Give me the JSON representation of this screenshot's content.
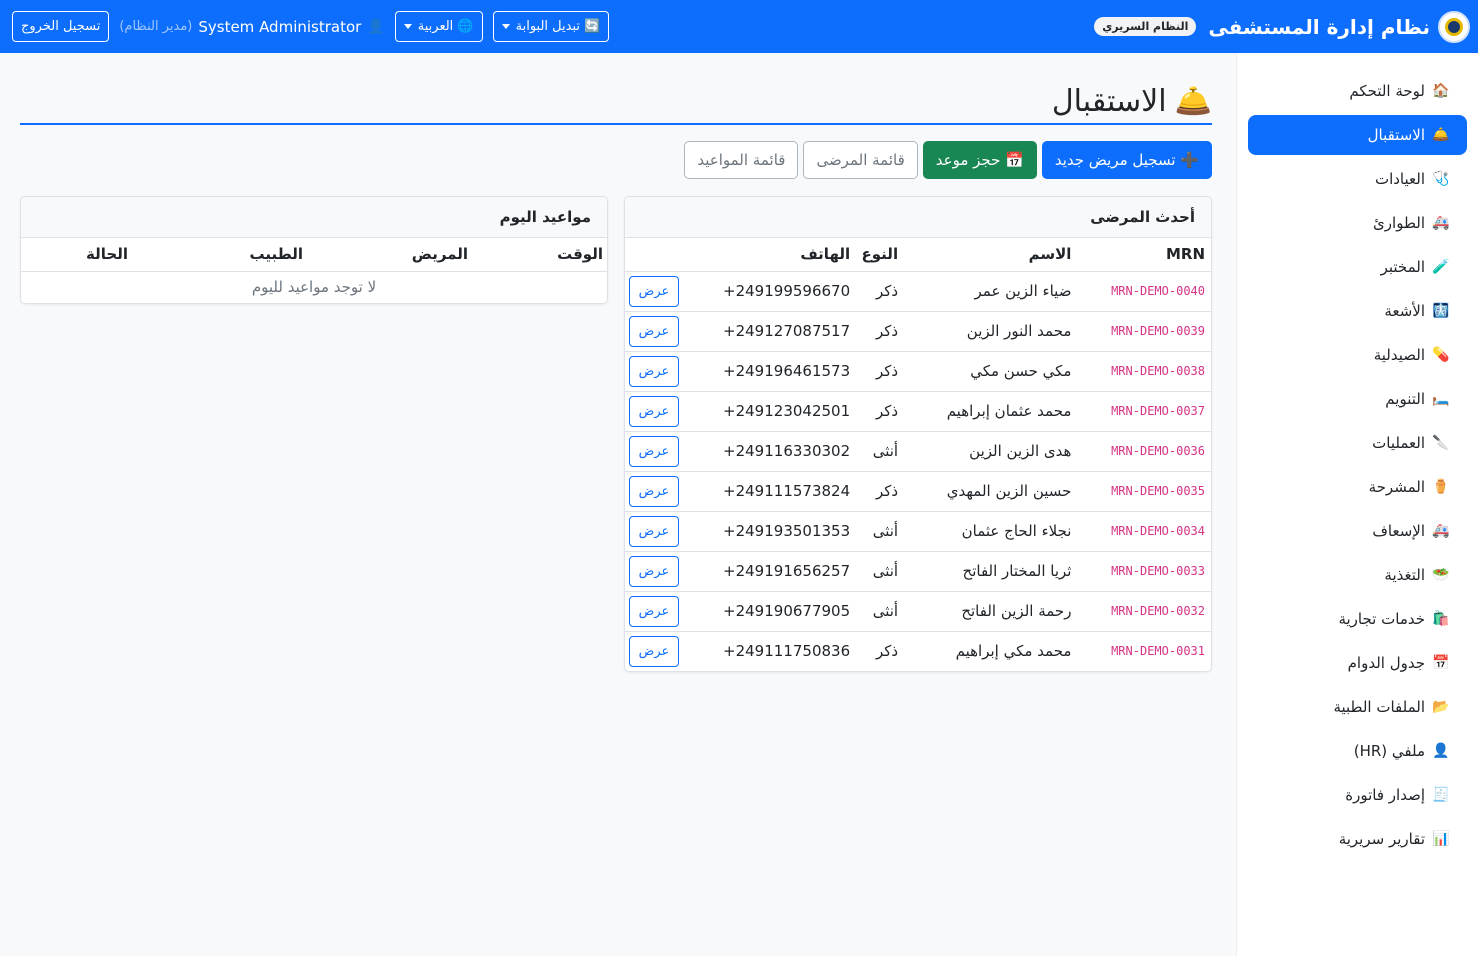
{
  "navbar": {
    "brand_title": "نظام إدارة المستشفى",
    "brand_badge": "النظام السريري",
    "portal_label": "🔄 تبديل البوابة",
    "language_label": "🌐 العربية",
    "user_name": "System Administrator",
    "user_role": "(مدير النظام)",
    "logout_label": "تسجيل الخروج"
  },
  "sidebar": {
    "items": [
      {
        "icon": "🏠",
        "label": "لوحة التحكم"
      },
      {
        "icon": "🛎️",
        "label": "الاستقبال"
      },
      {
        "icon": "🩺",
        "label": "العيادات"
      },
      {
        "icon": "🚑",
        "label": "الطوارئ"
      },
      {
        "icon": "🧪",
        "label": "المختبر"
      },
      {
        "icon": "🩻",
        "label": "الأشعة"
      },
      {
        "icon": "💊",
        "label": "الصيدلية"
      },
      {
        "icon": "🛏️",
        "label": "التنويم"
      },
      {
        "icon": "🔪",
        "label": "العمليات"
      },
      {
        "icon": "⚱️",
        "label": "المشرحة"
      },
      {
        "icon": "🚑",
        "label": "الإسعاف"
      },
      {
        "icon": "🥗",
        "label": "التغذية"
      },
      {
        "icon": "🛍️",
        "label": "خدمات تجارية"
      },
      {
        "icon": "📅",
        "label": "جدول الدوام"
      },
      {
        "icon": "📂",
        "label": "الملفات الطبية"
      },
      {
        "icon": "👤",
        "label": "ملفي (HR)"
      },
      {
        "icon": "🧾",
        "label": "إصدار فاتورة"
      },
      {
        "icon": "📊",
        "label": "تقارير سريرية"
      }
    ],
    "active_index": 1
  },
  "page": {
    "icon": "🛎️",
    "title": "الاستقبال"
  },
  "actions": {
    "register_patient": "➕ تسجيل مريض جديد",
    "book_appointment": "📅 حجز موعد",
    "patient_list": "قائمة المرضى",
    "appointment_list": "قائمة المواعيد"
  },
  "recent_patients": {
    "title": "أحدث المرضى",
    "columns": [
      "MRN",
      "الاسم",
      "النوع",
      "الهاتف",
      ""
    ],
    "view_label": "عرض",
    "rows": [
      {
        "mrn": "MRN-DEMO-0040",
        "name": "ضياء الزين عمر",
        "gender": "ذكر",
        "phone": "+249199596670"
      },
      {
        "mrn": "MRN-DEMO-0039",
        "name": "محمد النور الزين",
        "gender": "ذكر",
        "phone": "+249127087517"
      },
      {
        "mrn": "MRN-DEMO-0038",
        "name": "مكي حسن مكي",
        "gender": "ذكر",
        "phone": "+249196461573"
      },
      {
        "mrn": "MRN-DEMO-0037",
        "name": "محمد عثمان إبراهيم",
        "gender": "ذكر",
        "phone": "+249123042501"
      },
      {
        "mrn": "MRN-DEMO-0036",
        "name": "هدى الزين الزين",
        "gender": "أنثى",
        "phone": "+249116330302"
      },
      {
        "mrn": "MRN-DEMO-0035",
        "name": "حسين الزين المهدي",
        "gender": "ذكر",
        "phone": "+249111573824"
      },
      {
        "mrn": "MRN-DEMO-0034",
        "name": "نجلاء الحاج عثمان",
        "gender": "أنثى",
        "phone": "+249193501353"
      },
      {
        "mrn": "MRN-DEMO-0033",
        "name": "ثريا المختار الفاتح",
        "gender": "أنثى",
        "phone": "+249191656257"
      },
      {
        "mrn": "MRN-DEMO-0032",
        "name": "رحمة الزين الفاتح",
        "gender": "أنثى",
        "phone": "+249190677905"
      },
      {
        "mrn": "MRN-DEMO-0031",
        "name": "محمد مكي إبراهيم",
        "gender": "ذكر",
        "phone": "+249111750836"
      }
    ]
  },
  "todays_appointments": {
    "title": "مواعيد اليوم",
    "columns": [
      "الوقت",
      "المريض",
      "الطبيب",
      "الحالة"
    ],
    "empty_message": "لا توجد مواعيد لليوم"
  },
  "colors": {
    "primary": "#0d6efd",
    "success": "#198754",
    "mrn_code": "#d63384"
  }
}
